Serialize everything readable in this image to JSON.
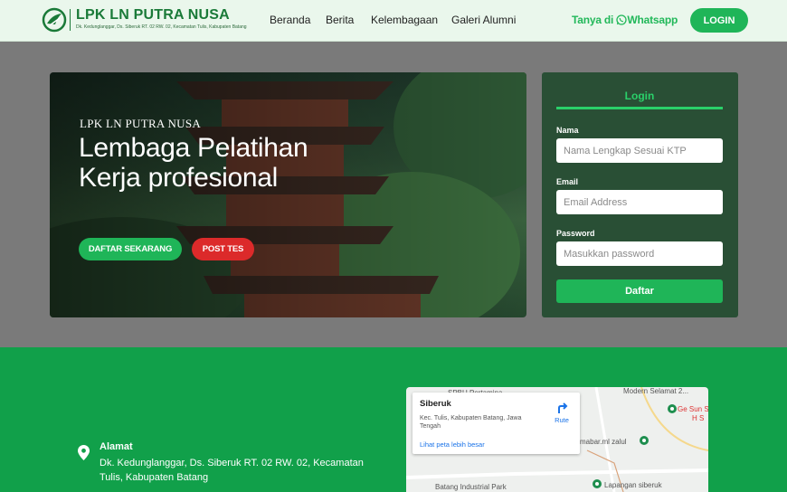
{
  "navbar": {
    "logo_title": "LPK LN PUTRA NUSA",
    "logo_subtitle": "Dk. Kedunglanggar, Ds. Siberuk RT. 02 RW. 02, Kecamatan Tulis, Kabupaten Batang",
    "links": [
      "Beranda",
      "Berita",
      "Kelembagaan",
      "Galeri Alumni"
    ],
    "whatsapp_label": "Tanya di",
    "whatsapp_name": "Whatsapp",
    "login_label": "LOGIN"
  },
  "hero": {
    "brand": "LPK LN PUTRA NUSA",
    "title": "Lembaga Pelatihan Kerja profesional",
    "primary_button": "DAFTAR SEKARANG",
    "secondary_button": "POST TES"
  },
  "login_card": {
    "title": "Login",
    "name_label": "Nama",
    "name_placeholder": "Nama Lengkap Sesuai KTP",
    "email_label": "Email",
    "email_placeholder": "Email Address",
    "password_label": "Password",
    "password_placeholder": "Masukkan password",
    "submit_label": "Daftar"
  },
  "footer": {
    "address_label": "Alamat",
    "address_text": "Dk. Kedunglanggar, Ds. Siberuk RT. 02 RW. 02, Kecamatan Tulis, Kabupaten Batang"
  },
  "map": {
    "place_name": "Siberuk",
    "place_address": "Kec. Tulis, Kabupaten Batang, Jawa Tengah",
    "larger_map_link": "Lihat peta lebih besar",
    "directions_label": "Rute",
    "labels": [
      "SPBU Pertamina",
      "Modern Selamat 2...",
      "Ge Sun Sa",
      "H S",
      "mabar.ml zalul",
      "Batang Industrial Park",
      "Lapangan siberuk"
    ]
  },
  "colors": {
    "brand_green": "#1fb558",
    "navbar_bg": "#eaf7ec",
    "card_bg": "#294f35",
    "footer_bg": "#11a04a",
    "danger": "#dc2a2a"
  }
}
